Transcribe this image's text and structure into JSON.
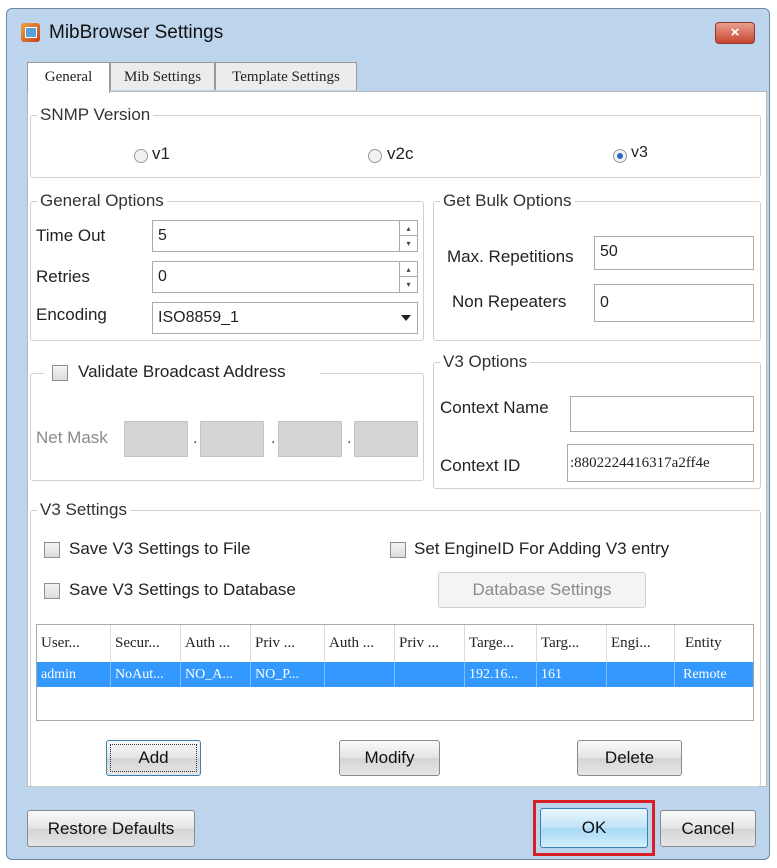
{
  "window": {
    "title": "MibBrowser Settings",
    "close_icon": "×"
  },
  "tabs": [
    {
      "label": "General",
      "active": true
    },
    {
      "label": "Mib Settings",
      "active": false
    },
    {
      "label": "Template Settings",
      "active": false
    }
  ],
  "snmp_version": {
    "legend": "SNMP Version",
    "options": [
      {
        "label": "v1",
        "selected": false
      },
      {
        "label": "v2c",
        "selected": false
      },
      {
        "label": "v3",
        "selected": true
      }
    ]
  },
  "general_options": {
    "legend": "General Options",
    "timeout": {
      "label": "Time Out",
      "value": "5"
    },
    "retries": {
      "label": "Retries",
      "value": "0"
    },
    "encoding": {
      "label": "Encoding",
      "value": "ISO8859_1"
    }
  },
  "get_bulk": {
    "legend": "Get Bulk Options",
    "max_repetitions": {
      "label": "Max. Repetitions",
      "value": "50"
    },
    "non_repeaters": {
      "label": "Non Repeaters",
      "value": "0"
    }
  },
  "broadcast": {
    "checkbox_label": "Validate Broadcast Address",
    "checked": false,
    "netmask_label": "Net Mask"
  },
  "v3_options": {
    "legend": "V3 Options",
    "context_name": {
      "label": "Context Name",
      "value": ""
    },
    "context_id": {
      "label": "Context ID",
      "value": ":8802224416317a2ff4e"
    }
  },
  "v3_settings": {
    "legend": "V3 Settings",
    "save_to_file": "Save V3 Settings to File",
    "set_engine_id": "Set EngineID For Adding V3 entry",
    "save_to_db": "Save V3 Settings to Database",
    "db_settings_button": "Database Settings",
    "columns": [
      "User...",
      "Secur...",
      "Auth ...",
      "Priv ...",
      "Auth ...",
      "Priv ...",
      "Targe...",
      "Targ...",
      "Engi...",
      "Entity"
    ],
    "rows": [
      [
        "admin",
        "NoAut...",
        "NO_A...",
        "NO_P...",
        "",
        "",
        "192.16...",
        "161",
        "",
        "Remote"
      ]
    ],
    "add_button": "Add",
    "modify_button": "Modify",
    "delete_button": "Delete"
  },
  "footer": {
    "restore_button": "Restore Defaults",
    "ok_button": "OK",
    "cancel_button": "Cancel"
  },
  "colors": {
    "selection": "#3399ff",
    "highlight_box": "#d91f26",
    "window_frame": "#bcd4ec"
  }
}
